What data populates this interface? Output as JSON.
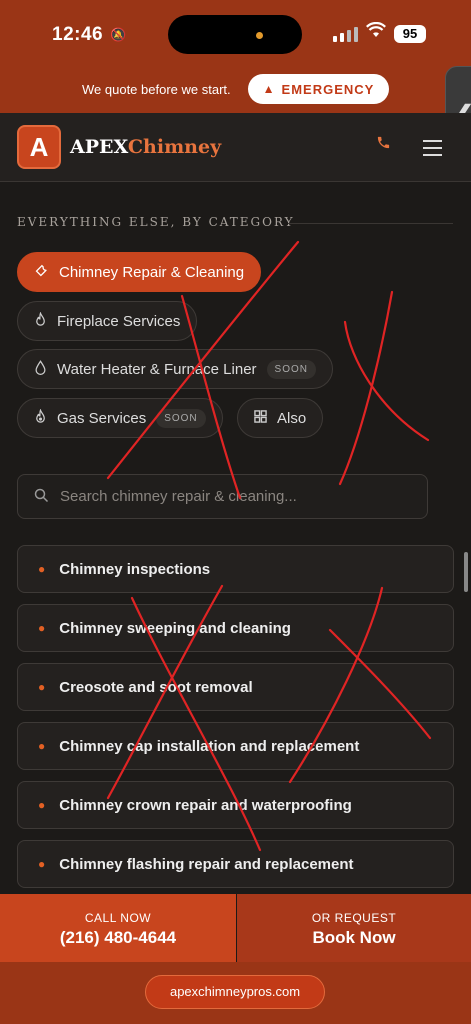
{
  "status_bar": {
    "time": "12:46",
    "battery": "95"
  },
  "top_bar": {
    "quote_text": "We quote before we start.",
    "emergency_label": "EMERGENCY"
  },
  "side_tab": {
    "glyph": "❮"
  },
  "header": {
    "logo_letter": "A",
    "brand_part1": "APEX",
    "brand_part2": "Chimney"
  },
  "section": {
    "title": "EVERYTHING ELSE, BY CATEGORY"
  },
  "categories": [
    {
      "label": "Chimney Repair & Cleaning",
      "icon": "wrench-icon",
      "active": true
    },
    {
      "label": "Fireplace Services",
      "icon": "flame-icon",
      "active": false
    },
    {
      "label": "Water Heater & Furnace Liner",
      "icon": "drop-icon",
      "active": false,
      "badge": "SOON"
    },
    {
      "label": "Gas Services",
      "icon": "gas-flame-icon",
      "active": false,
      "badge": "SOON"
    },
    {
      "label": "Also",
      "icon": "grid-icon",
      "active": false
    }
  ],
  "search": {
    "placeholder": "Search chimney repair & cleaning..."
  },
  "services": [
    "Chimney inspections",
    "Chimney sweeping and cleaning",
    "Creosote and soot removal",
    "Chimney cap installation and replacement",
    "Chimney crown repair and waterproofing",
    "Chimney flashing repair and replacement"
  ],
  "bottom_bar": {
    "call_label": "CALL NOW",
    "phone": "(216) 480-4644",
    "request_label": "OR REQUEST",
    "book_label": "Book Now"
  },
  "footer": {
    "site": "apexchimneypros.com"
  },
  "colors": {
    "brand": "#c8451e",
    "status_bg": "#9a3516",
    "page_bg": "#1c1a18",
    "accent_orange": "#e8743e",
    "scribble_red": "#e02424"
  }
}
